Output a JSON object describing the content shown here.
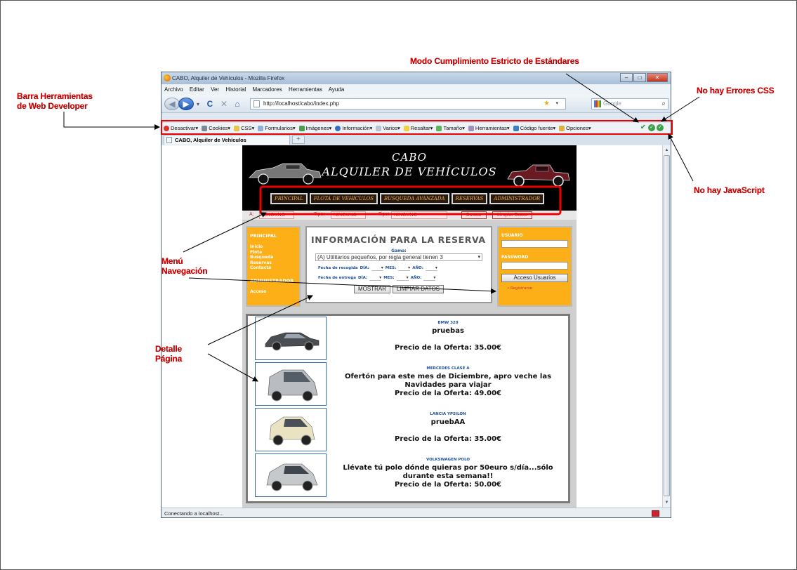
{
  "callouts": {
    "toolbar_line1": "Barra Herramientas",
    "toolbar_line2": "de Web Developer",
    "standards": "Modo Cumplimiento Estricto de Estándares",
    "css": "No hay Errores CSS",
    "js": "No hay JavaScript",
    "menu_line1": "Menú",
    "menu_line2": "Navegación",
    "detail_line1": "Detalle",
    "detail_line2": "Página"
  },
  "window": {
    "title": "CABO, Alquiler de Vehículos - Mozilla Firefox",
    "menu": [
      "Archivo",
      "Editar",
      "Ver",
      "Historial",
      "Marcadores",
      "Herramientas",
      "Ayuda"
    ],
    "url": "http://localhost/cabo/index.php",
    "search_placeholder": "Google",
    "tab_label": "CABO, Alquiler de Vehículos",
    "status": "Conectando a localhost..."
  },
  "webdev": {
    "items": [
      "Desactivar▾",
      "Cookies▾",
      "CSS▾",
      "Formularios▾",
      "Imágenes▾",
      "Información▾",
      "Varios▾",
      "Resaltar▾",
      "Tamaño▾",
      "Herramientas▾",
      "Código fuente▾",
      "Opciones▾"
    ]
  },
  "site": {
    "title_line1": "CABO",
    "title_line2": "ALQUILER DE VEHÍCULOS",
    "nav": [
      "PRINCIPAL",
      "FLOTA DE VEHICULOS",
      "BUSQUEDA AVANZADA",
      "RESERVAS",
      "ADMINISTRADOR"
    ],
    "search": {
      "label1": "A:",
      "label2": "Tipo:",
      "label3": "Tipo:",
      "field_value": "NINGUNO",
      "button1": "Buscar",
      "button2": "Limpiar Datos"
    },
    "left_nav": {
      "heading1": "PRINCIPAL",
      "heading2": "ADMINISTRADOR",
      "links": [
        "Inicio",
        "Flota",
        "Busqueda",
        "Reservas",
        "Contacta",
        "Acceso"
      ]
    },
    "reserva": {
      "title": "INFORMACIÓN PARA LA RESERVA",
      "gama_label": "Gama:",
      "gama_value": "(A) Utilitarios pequeños, por regla general tienen 3",
      "pickup_label": "Fecha de recogida",
      "return_label": "Fecha de entrega",
      "day_label": "DÍA:",
      "month_label": "MES:",
      "year_label": "AÑO:",
      "show_button": "MOSTRAR",
      "clear_button": "LIMPIAR DATOS"
    },
    "login": {
      "user_label": "USUARIO",
      "password_label": "PASSWORD",
      "access_button": "Acceso Usuarios",
      "register_link": "Registrarse"
    }
  },
  "offers": [
    {
      "model": "BMW 320",
      "description": "pruebas",
      "price": "Precio de la Oferta: 35.00€"
    },
    {
      "model": "MERCEDES CLASE A",
      "description": "Ofertón para este mes de Diciembre, apro veche las Navidades para viajar",
      "price": "Precio de la Oferta: 49.00€"
    },
    {
      "model": "LANCIA YPSILON",
      "description": "pruebAA",
      "price": "Precio de la Oferta: 35.00€"
    },
    {
      "model": "VOLKSWAGEN POLO",
      "description": "Llévate tú polo dónde quieras por 50euro s/día...sólo durante esta semana!!",
      "price": "Precio de la Oferta: 50.00€"
    }
  ]
}
